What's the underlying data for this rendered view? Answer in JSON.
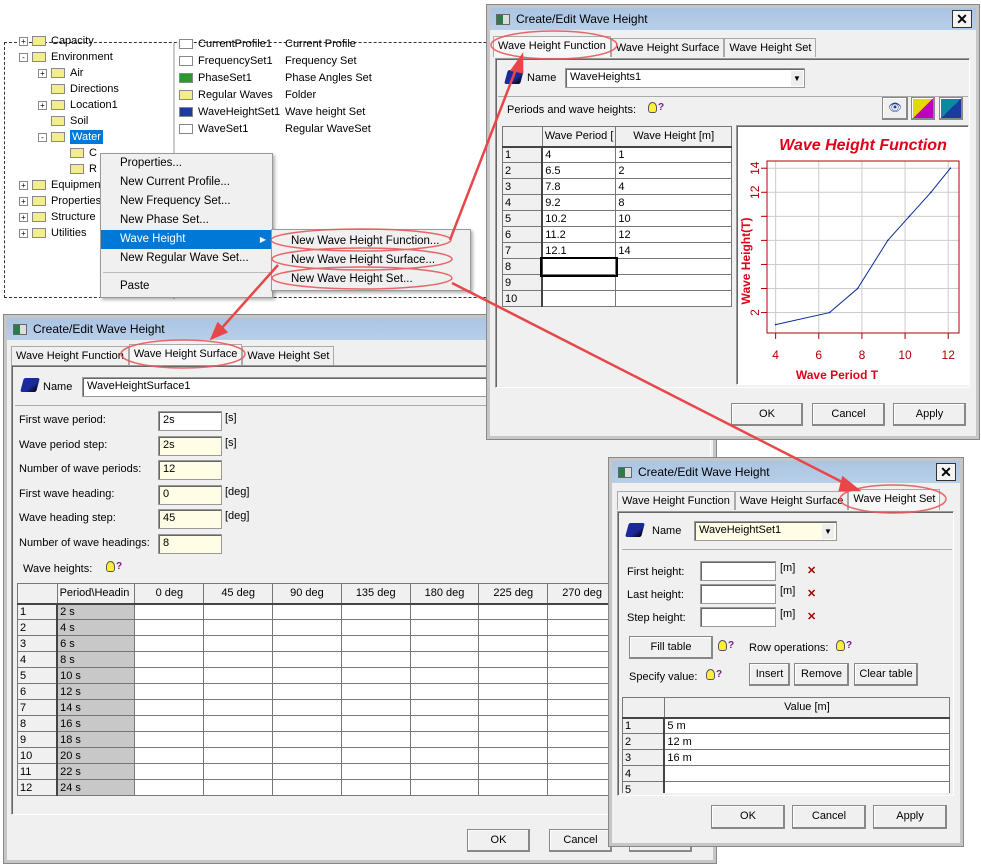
{
  "tree": {
    "items": [
      {
        "label": "Capacity",
        "level": 0,
        "expander": "+"
      },
      {
        "label": "Environment",
        "level": 0,
        "expander": "-"
      },
      {
        "label": "Air",
        "level": 1,
        "expander": "+"
      },
      {
        "label": "Directions",
        "level": 1,
        "expander": ""
      },
      {
        "label": "Location1",
        "level": 1,
        "expander": "+"
      },
      {
        "label": "Soil",
        "level": 1,
        "expander": ""
      },
      {
        "label": "Water",
        "level": 1,
        "expander": "-",
        "selected": true
      },
      {
        "label": "C",
        "level": 2,
        "expander": ""
      },
      {
        "label": "R",
        "level": 2,
        "expander": ""
      },
      {
        "label": "Equipment",
        "level": 0,
        "expander": "+"
      },
      {
        "label": "Properties",
        "level": 0,
        "expander": "+"
      },
      {
        "label": "Structure",
        "level": 0,
        "expander": "+"
      },
      {
        "label": "Utilities",
        "level": 0,
        "expander": "+"
      }
    ]
  },
  "list": {
    "items": [
      {
        "name": "CurrentProfile1",
        "type": "Current Profile",
        "icon": "current-profile-icon"
      },
      {
        "name": "FrequencySet1",
        "type": "Frequency Set",
        "icon": "frequency-icon"
      },
      {
        "name": "PhaseSet1",
        "type": "Phase Angles Set",
        "icon": "phase-icon"
      },
      {
        "name": "Regular Waves",
        "type": "Folder",
        "icon": "folder-icon"
      },
      {
        "name": "WaveHeightSet1",
        "type": "Wave height Set",
        "icon": "wave-height-icon"
      },
      {
        "name": "WaveSet1",
        "type": "Regular WaveSet",
        "icon": "wave-icon"
      }
    ]
  },
  "context_menu": {
    "items": [
      "Properties...",
      "New Current Profile...",
      "New Frequency Set...",
      "New Phase Set...",
      "Wave Height",
      "New Regular Wave Set...",
      "Paste"
    ],
    "selected": "Wave Height"
  },
  "submenu": {
    "items": [
      "New Wave Height Function...",
      "New Wave Height Surface...",
      "New Wave Height Set..."
    ]
  },
  "dialog_title": "Create/Edit Wave Height",
  "tabs": [
    "Wave Height Function",
    "Wave Height Surface",
    "Wave Height Set"
  ],
  "buttons": {
    "ok": "OK",
    "cancel": "Cancel",
    "apply": "Apply"
  },
  "name_label": "Name",
  "function_dialog": {
    "name": "WaveHeights1",
    "section_label": "Periods and wave heights:",
    "help": "?",
    "columns": [
      "",
      "Wave Period [",
      "Wave Height [m]"
    ],
    "rows": [
      [
        "1",
        "4",
        "1"
      ],
      [
        "2",
        "6.5",
        "2"
      ],
      [
        "3",
        "7.8",
        "4"
      ],
      [
        "4",
        "9.2",
        "8"
      ],
      [
        "5",
        "10.2",
        "10"
      ],
      [
        "6",
        "11.2",
        "12"
      ],
      [
        "7",
        "12.1",
        "14"
      ],
      [
        "8",
        "",
        ""
      ],
      [
        "9",
        "",
        ""
      ],
      [
        "10",
        "",
        ""
      ]
    ]
  },
  "chart_data": {
    "type": "line",
    "title": "Wave Height Function",
    "xlabel": "Wave Period T",
    "ylabel": "Wave Height(T)",
    "x": [
      4,
      6.5,
      7.8,
      9.2,
      10.2,
      11.2,
      12.1
    ],
    "series": [
      {
        "values": [
          1,
          2,
          4,
          8,
          10,
          12,
          14
        ]
      }
    ],
    "xticks": [
      "4",
      "6",
      "8",
      "10",
      "12"
    ],
    "yticks": [
      "2",
      "12",
      "14"
    ],
    "xlim": [
      3.6,
      12.5
    ],
    "ylim": [
      0.3,
      14.6
    ],
    "grid": true,
    "colors": {
      "title": "#e0001a",
      "line": "#0a2a9a",
      "axis": "#b00000"
    }
  },
  "surface_dialog": {
    "name": "WaveHeightSurface1",
    "fields": [
      {
        "label": "First wave period:",
        "value": "2s",
        "unit": "[s]"
      },
      {
        "label": "Wave period step:",
        "value": "2s",
        "unit": "[s]"
      },
      {
        "label": "Number of wave periods:",
        "value": "12",
        "unit": ""
      },
      {
        "label": "First wave heading:",
        "value": "0",
        "unit": "[deg]"
      },
      {
        "label": "Wave heading step:",
        "value": "45",
        "unit": "[deg]"
      },
      {
        "label": "Number of wave headings:",
        "value": "8",
        "unit": ""
      }
    ],
    "grid_label": "Wave heights:",
    "columns": [
      "",
      "Period\\Headin",
      "0 deg",
      "45 deg",
      "90 deg",
      "135 deg",
      "180 deg",
      "225 deg",
      "270 deg"
    ],
    "rows": [
      [
        "1",
        "2 s"
      ],
      [
        "2",
        "4 s"
      ],
      [
        "3",
        "6 s"
      ],
      [
        "4",
        "8 s"
      ],
      [
        "5",
        "10 s"
      ],
      [
        "6",
        "12 s"
      ],
      [
        "7",
        "14 s"
      ],
      [
        "8",
        "16 s"
      ],
      [
        "9",
        "18 s"
      ],
      [
        "10",
        "20 s"
      ],
      [
        "11",
        "22 s"
      ],
      [
        "12",
        "24 s"
      ]
    ]
  },
  "set_dialog": {
    "name": "WaveHeightSet1",
    "fields": [
      {
        "label": "First height:",
        "value": "",
        "unit": "[m]"
      },
      {
        "label": "Last height:",
        "value": "",
        "unit": "[m]"
      },
      {
        "label": "Step height:",
        "value": "",
        "unit": "[m]"
      }
    ],
    "fill_table": "Fill table",
    "row_operations": "Row operations:",
    "specify_value": "Specify value:",
    "insert": "Insert",
    "remove": "Remove",
    "clear_table": "Clear table",
    "columns": [
      "",
      "Value [m]"
    ],
    "rows": [
      [
        "1",
        "5 m"
      ],
      [
        "2",
        "12 m"
      ],
      [
        "3",
        "16 m"
      ],
      [
        "4",
        ""
      ],
      [
        "5",
        ""
      ]
    ]
  }
}
